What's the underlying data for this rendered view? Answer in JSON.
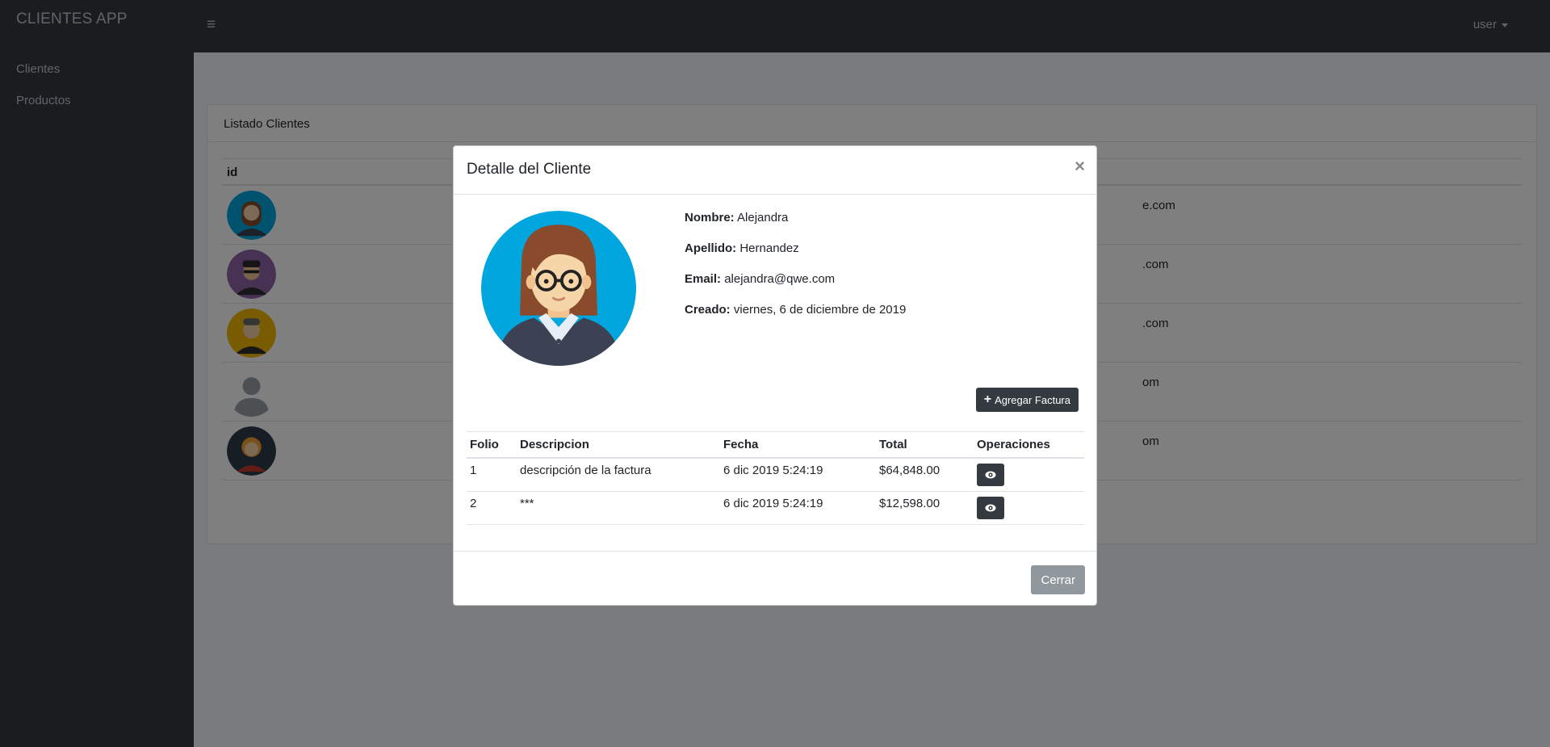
{
  "app": {
    "brand": "CLIENTES APP",
    "user": "user"
  },
  "sidebar": {
    "items": [
      {
        "label": "Clientes"
      },
      {
        "label": "Productos"
      }
    ]
  },
  "list": {
    "title": "Listado Clientes",
    "header_id": "id",
    "email_fragments": [
      "e.com",
      ".com",
      ".com",
      "om",
      "om"
    ]
  },
  "modal": {
    "title": "Detalle del Cliente",
    "close": "×",
    "fields": {
      "nombre_label": "Nombre:",
      "nombre": "Alejandra",
      "apellido_label": "Apellido:",
      "apellido": "Hernandez",
      "email_label": "Email:",
      "email": "alejandra@qwe.com",
      "creado_label": "Creado:",
      "creado": "viernes, 6 de diciembre de 2019"
    },
    "add_invoice": "Agregar Factura",
    "invoices": {
      "headers": [
        "Folio",
        "Descripcion",
        "Fecha",
        "Total",
        "Operaciones"
      ],
      "rows": [
        {
          "folio": "1",
          "descripcion": "descripción de la factura",
          "fecha": "6 dic 2019 5:24:19",
          "total": "$64,848.00"
        },
        {
          "folio": "2",
          "descripcion": "***",
          "fecha": "6 dic 2019 5:24:19",
          "total": "$12,598.00"
        }
      ]
    },
    "close_button": "Cerrar"
  },
  "colors": {
    "sidebar": "#343a40",
    "primary_dark": "#343a40",
    "secondary": "#6c757d",
    "avatar_blue": "#00a6dd"
  }
}
